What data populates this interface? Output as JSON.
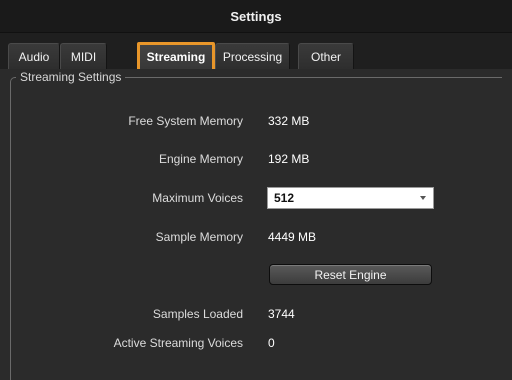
{
  "window": {
    "title": "Settings"
  },
  "tabs": [
    {
      "label": "Audio",
      "active": false
    },
    {
      "label": "MIDI",
      "active": false
    },
    {
      "label": "Streaming",
      "active": true
    },
    {
      "label": "Processing",
      "active": false
    },
    {
      "label": "Other",
      "active": false
    }
  ],
  "colors": {
    "highlight": "#e8962a",
    "background": "#2b2b2b"
  },
  "streaming": {
    "group_title": "Streaming Settings",
    "free_system_memory": {
      "label": "Free System Memory",
      "value": "332 MB"
    },
    "engine_memory": {
      "label": "Engine Memory",
      "value": "192 MB"
    },
    "maximum_voices": {
      "label": "Maximum Voices",
      "value": "512"
    },
    "sample_memory": {
      "label": "Sample Memory",
      "value": "4449 MB"
    },
    "reset_button": "Reset Engine",
    "samples_loaded": {
      "label": "Samples Loaded",
      "value": "3744"
    },
    "active_streaming_voices": {
      "label": "Active Streaming Voices",
      "value": "0"
    }
  }
}
